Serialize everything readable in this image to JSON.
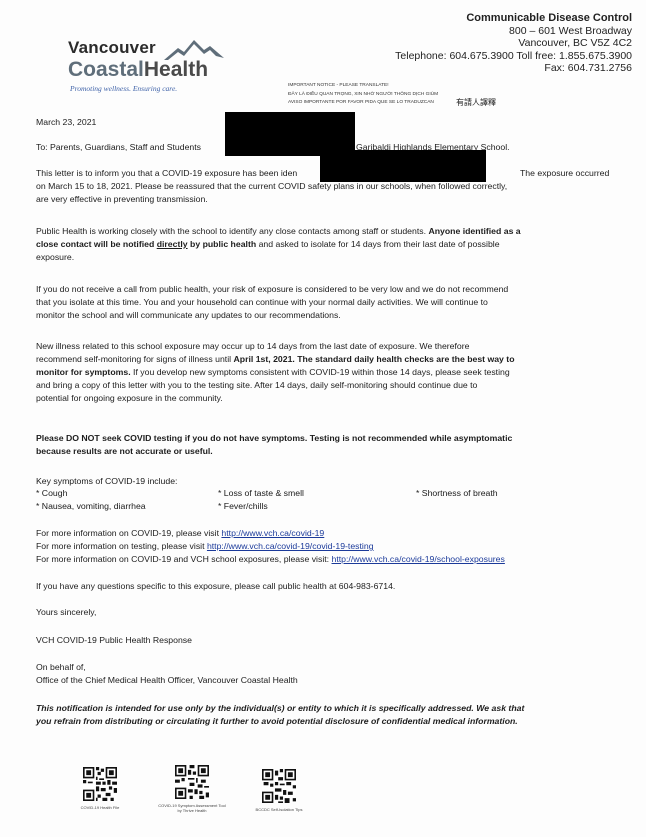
{
  "header": {
    "logo_line1": "Vancouver",
    "logo_coastal": "Coastal",
    "logo_health": "Health",
    "logo_tagline": "Promoting wellness. Ensuring care.",
    "notice_lines": [
      "IMPORTANT NOTICE - PLEASE TRANSLATE!",
      "ĐÂY LÀ ĐIỀU QUAN TRỌNG, XIN NHỜ NGƯỜI THÔNG DỊCH GIÙM",
      "AVISO IMPORTANTE POR FAVOR PIDA QUE SE LO TRADUZCAN"
    ],
    "notice_chinese": "有請人譯釋",
    "dept": "Communicable Disease Control",
    "address1": "800 – 601 West Broadway",
    "address2": "Vancouver, BC V5Z 4C2",
    "phone": "Telephone: 604.675.3900 Toll free: 1.855.675.3900",
    "fax": "Fax:  604.731.2756"
  },
  "letter": {
    "date": "March 23, 2021",
    "to_prefix": "To: Parents, Guardians, Staff and Students",
    "to_school": "Garibaldi Highlands Elementary School.",
    "p1_a": "This letter is to inform you that a COVID-19 exposure has been iden",
    "p1_b": "The exposure occurred",
    "p1_c": "on March 15 to 18, 2021. Please be reassured that the current COVID safety plans in our schools, when followed correctly,",
    "p1_d": "are very effective in preventing transmission.",
    "p2_a": "Public Health is working closely with the school to identify any close contacts among staff or students.",
    "p2_b": "Anyone identified as a",
    "p2_c": "close contact will be notified",
    "p2_d": "directly",
    "p2_e": "by public health",
    "p2_f": "and asked to isolate for 14 days from their last date of possible",
    "p2_g": "exposure.",
    "p3_a": "If you do not receive a call from public health, your risk of exposure is considered to be very low and we do not recommend",
    "p3_b": "that you isolate at this time. You and your household can continue with your normal daily activities. We will continue to",
    "p3_c": "monitor the school and will communicate any updates to our recommendations.",
    "p4_a": "New illness related to this school exposure may occur up to 14 days from the last date of exposure. We therefore",
    "p4_b": "recommend self-monitoring for signs of illness until",
    "p4_c": "April 1st, 2021. The standard daily health checks are the best way to",
    "p4_d": "monitor for symptoms.",
    "p4_e": "If you develop new symptoms consistent with COVID-19 within those 14 days, please seek testing",
    "p4_f": "and bring a copy of this letter with you to the testing site.  After 14 days, daily self-monitoring should continue due to",
    "p4_g": "potential for ongoing exposure in the community.",
    "p5_a": "Please DO NOT seek COVID testing if you do not have symptoms. Testing is not recommended while asymptomatic",
    "p5_b": "because results are not accurate or useful.",
    "symptoms_heading": "Key symptoms of COVID-19 include:",
    "symptoms": [
      "* Cough",
      "* Loss of taste & smell",
      "* Shortness of breath",
      "* Nausea, vomiting, diarrhea",
      "* Fever/chills"
    ],
    "info1_text": "For more information on COVID-19, please visit",
    "info1_link": "http://www.vch.ca/covid-19",
    "info2_text": "For more information on testing, please visit",
    "info2_link": "http://www.vch.ca/covid-19/covid-19-testing",
    "info3_text": "For more information on COVID-19 and VCH school exposures, please visit:",
    "info3_link": "http://www.vch.ca/covid-19/school-exposures",
    "questions": "If you have any questions specific to this exposure, please call public health at 604-983-6714.",
    "closing": "Yours sincerely,",
    "signature": "VCH COVID-19 Public Health Response",
    "behalf1": "On behalf of,",
    "behalf2": "Office of the Chief Medical Health Officer, Vancouver Coastal Health",
    "disclaimer_a": "This notification is intended for use only by the individual(s) or entity to which it is specifically addressed. We ask that",
    "disclaimer_b": "you refrain from distributing or circulating it further to avoid potential disclosure of confidential medical information."
  },
  "qr_codes": [
    {
      "label": "COVID-19 Health File"
    },
    {
      "label": "COVID-19 Symptom Assessment Tool by Thrive Health"
    },
    {
      "label": "BCCDC Self-Isolation Tips"
    }
  ]
}
